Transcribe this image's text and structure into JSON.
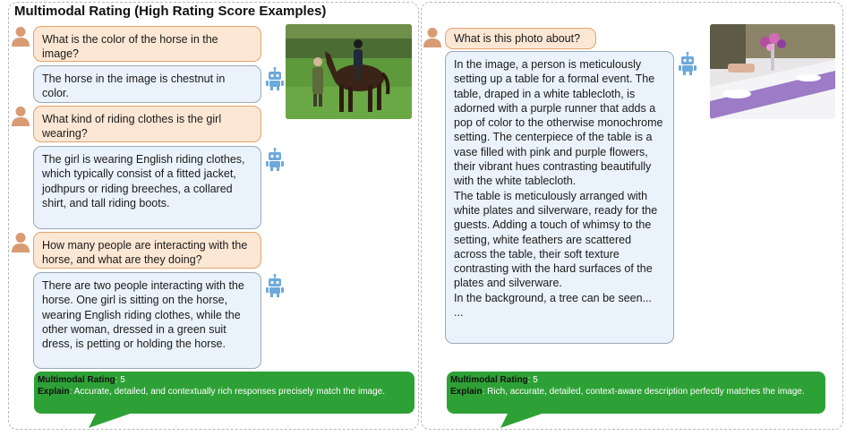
{
  "title": "Multimodal Rating (High Rating Score Examples)",
  "left": {
    "messages": [
      {
        "role": "user",
        "text": "What is the color of the horse in the image?"
      },
      {
        "role": "assistant",
        "text": "The horse in the image is chestnut in color."
      },
      {
        "role": "user",
        "text": "What kind of riding clothes is the girl wearing?"
      },
      {
        "role": "assistant",
        "text": "The girl is wearing English riding clothes, which typically consist of a fitted jacket, jodhpurs or riding breeches, a collared shirt, and tall riding boots."
      },
      {
        "role": "user",
        "text": "How many people are interacting with the horse, and what are they doing?"
      },
      {
        "role": "assistant",
        "text": "There are two people interacting with the horse. One girl is sitting on the horse, wearing English riding clothes, while the other woman, dressed in a green suit dress, is petting or holding the horse."
      }
    ],
    "rating": {
      "rating_label": "Multimodal Rating",
      "rating_value": ": 5",
      "explain_label": "Explain",
      "explain_text": ": Accurate, detailed, and contextually rich responses precisely match the image."
    }
  },
  "right": {
    "messages": [
      {
        "role": "user",
        "text": "What is this photo about?"
      },
      {
        "role": "assistant",
        "text": "In the image, a person is meticulously setting up a table for a formal event. The table, draped in a white tablecloth, is adorned with a purple runner that adds a pop of color to the otherwise monochrome setting. The centerpiece of the table is a vase filled with pink and purple flowers, their vibrant hues contrasting beautifully with the white tablecloth.\nThe table is meticulously arranged with white plates and silverware, ready for the guests. Adding a touch of whimsy to the setting, white feathers are scattered across the table, their soft texture contrasting with the hard surfaces of the plates and silverware.\nIn the background, a tree can be seen...\n..."
      }
    ],
    "rating": {
      "rating_label": "Multimodal Rating",
      "rating_value": ": 5",
      "explain_label": "Explain",
      "explain_text": ": Rich, accurate, detailed, context-aware description perfectly matches the image."
    }
  },
  "icons": {
    "user": "person-icon",
    "assistant": "robot-icon",
    "user_color": "#d89b73",
    "assistant_color": "#6ea9dc"
  },
  "colors": {
    "question_bg": "#fce7d4",
    "question_border": "#e2a46c",
    "answer_bg": "#eaf2fb",
    "answer_border": "#9aa9bb",
    "rating_bg": "#2ea136"
  }
}
